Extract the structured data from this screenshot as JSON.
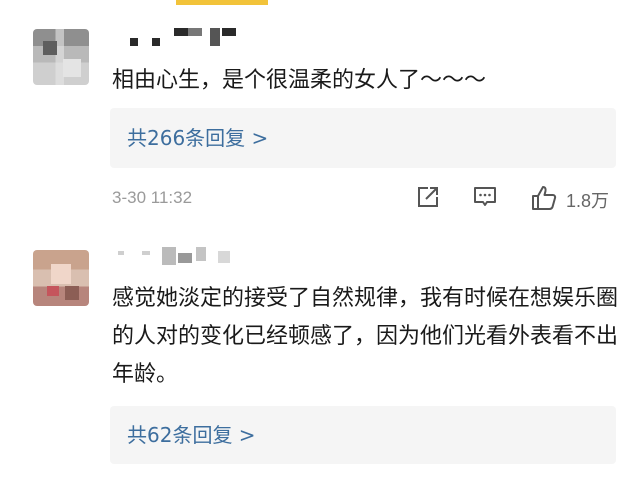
{
  "comments": [
    {
      "text": "相由心生，是个很温柔的女人了～～～",
      "reply_summary": "共266条回复 >",
      "timestamp": "3-30 11:32",
      "likes": "1.8万"
    },
    {
      "text": "感觉她淡定的接受了自然规律，我有时候在想娱乐圈的人对的变化已经顿感了，因为他们光看外表看不出年龄。",
      "reply_summary": "共62条回复 >"
    }
  ],
  "icons": {
    "share": "share-icon",
    "comment": "comment-icon",
    "like": "thumbs-up-icon"
  },
  "colors": {
    "link": "#3d6e9e",
    "reply_box_bg": "#f5f5f5",
    "text": "#1a1a1a",
    "meta": "#9a9a9a",
    "accent_bar": "#f2c33a"
  }
}
